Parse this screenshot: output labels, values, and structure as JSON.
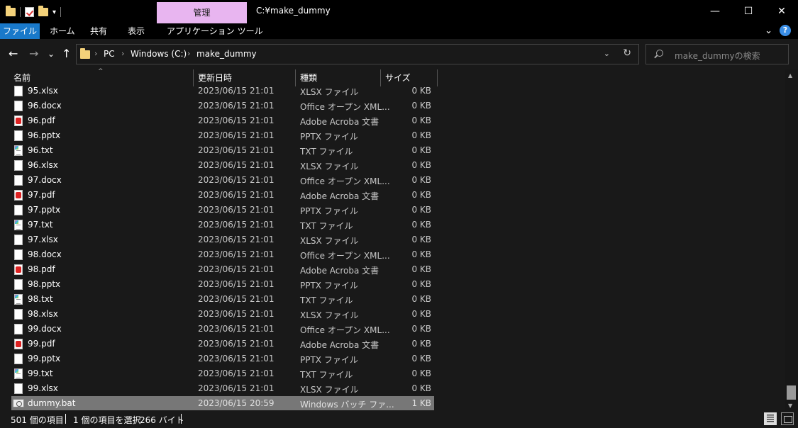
{
  "window": {
    "title": "C:¥make_dummy",
    "context_tab": "管理",
    "minimize_glyph": "—",
    "maximize_glyph": "☐",
    "close_glyph": "✕"
  },
  "ribbon": {
    "tabs": [
      "ファイル",
      "ホーム",
      "共有",
      "表示",
      "アプリケーション ツール"
    ],
    "collapse_glyph": "⌄",
    "help_glyph": "?"
  },
  "nav": {
    "back_glyph": "←",
    "forward_glyph": "→",
    "recent_glyph": "⌄",
    "up_glyph": "↑"
  },
  "address": {
    "breadcrumbs": [
      "PC",
      "Windows (C:)",
      "make_dummy"
    ],
    "separator": "›",
    "dropdown_glyph": "⌄",
    "refresh_glyph": "↻"
  },
  "search": {
    "placeholder": "make_dummyの検索"
  },
  "columns": {
    "name": "名前",
    "date": "更新日時",
    "type": "種類",
    "size": "サイズ",
    "sort_glyph": "^"
  },
  "files": [
    {
      "name": "95.xlsx",
      "date": "2023/06/15 21:01",
      "type": "XLSX ファイル",
      "size": "0 KB",
      "icon": "doc"
    },
    {
      "name": "96.docx",
      "date": "2023/06/15 21:01",
      "type": "Office オープン XML...",
      "size": "0 KB",
      "icon": "doc"
    },
    {
      "name": "96.pdf",
      "date": "2023/06/15 21:01",
      "type": "Adobe Acroba 文書",
      "size": "0 KB",
      "icon": "pdf"
    },
    {
      "name": "96.pptx",
      "date": "2023/06/15 21:01",
      "type": "PPTX ファイル",
      "size": "0 KB",
      "icon": "doc"
    },
    {
      "name": "96.txt",
      "date": "2023/06/15 21:01",
      "type": "TXT ファイル",
      "size": "0 KB",
      "icon": "txt"
    },
    {
      "name": "96.xlsx",
      "date": "2023/06/15 21:01",
      "type": "XLSX ファイル",
      "size": "0 KB",
      "icon": "doc"
    },
    {
      "name": "97.docx",
      "date": "2023/06/15 21:01",
      "type": "Office オープン XML...",
      "size": "0 KB",
      "icon": "doc"
    },
    {
      "name": "97.pdf",
      "date": "2023/06/15 21:01",
      "type": "Adobe Acroba 文書",
      "size": "0 KB",
      "icon": "pdf"
    },
    {
      "name": "97.pptx",
      "date": "2023/06/15 21:01",
      "type": "PPTX ファイル",
      "size": "0 KB",
      "icon": "doc"
    },
    {
      "name": "97.txt",
      "date": "2023/06/15 21:01",
      "type": "TXT ファイル",
      "size": "0 KB",
      "icon": "txt"
    },
    {
      "name": "97.xlsx",
      "date": "2023/06/15 21:01",
      "type": "XLSX ファイル",
      "size": "0 KB",
      "icon": "doc"
    },
    {
      "name": "98.docx",
      "date": "2023/06/15 21:01",
      "type": "Office オープン XML...",
      "size": "0 KB",
      "icon": "doc"
    },
    {
      "name": "98.pdf",
      "date": "2023/06/15 21:01",
      "type": "Adobe Acroba 文書",
      "size": "0 KB",
      "icon": "pdf"
    },
    {
      "name": "98.pptx",
      "date": "2023/06/15 21:01",
      "type": "PPTX ファイル",
      "size": "0 KB",
      "icon": "doc"
    },
    {
      "name": "98.txt",
      "date": "2023/06/15 21:01",
      "type": "TXT ファイル",
      "size": "0 KB",
      "icon": "txt"
    },
    {
      "name": "98.xlsx",
      "date": "2023/06/15 21:01",
      "type": "XLSX ファイル",
      "size": "0 KB",
      "icon": "doc"
    },
    {
      "name": "99.docx",
      "date": "2023/06/15 21:01",
      "type": "Office オープン XML...",
      "size": "0 KB",
      "icon": "doc"
    },
    {
      "name": "99.pdf",
      "date": "2023/06/15 21:01",
      "type": "Adobe Acroba 文書",
      "size": "0 KB",
      "icon": "pdf"
    },
    {
      "name": "99.pptx",
      "date": "2023/06/15 21:01",
      "type": "PPTX ファイル",
      "size": "0 KB",
      "icon": "doc"
    },
    {
      "name": "99.txt",
      "date": "2023/06/15 21:01",
      "type": "TXT ファイル",
      "size": "0 KB",
      "icon": "txt"
    },
    {
      "name": "99.xlsx",
      "date": "2023/06/15 21:01",
      "type": "XLSX ファイル",
      "size": "0 KB",
      "icon": "doc"
    },
    {
      "name": "dummy.bat",
      "date": "2023/06/15 20:59",
      "type": "Windows バッチ ファ...",
      "size": "1 KB",
      "icon": "bat",
      "selected": true
    }
  ],
  "status": {
    "item_count": "501 個の項目",
    "selection": "1 個の項目を選択",
    "selection_size": "266 バイト"
  },
  "scrollbar": {
    "up_glyph": "▲",
    "down_glyph": "▼"
  },
  "colors": {
    "file_tab": "#1979ca",
    "context_tab": "#e8b5f0",
    "selection": "#777777",
    "folder": "#f4d27a"
  }
}
